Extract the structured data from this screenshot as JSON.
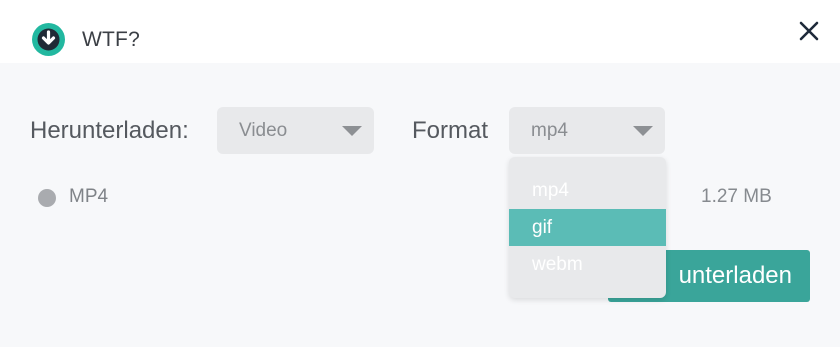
{
  "window": {
    "title": "WTF?",
    "logo_icon": "download-circle-icon",
    "close_icon": "close-icon"
  },
  "form": {
    "download_label": "Herunterladen:",
    "type_select": {
      "value": "Video",
      "icon": "caret-down-icon"
    },
    "format_label": "Format",
    "format_select": {
      "value": "mp4",
      "icon": "caret-down-icon"
    },
    "format_options": [
      "mp4",
      "gif",
      "webm"
    ],
    "highlighted_option": "gif"
  },
  "file": {
    "radio_label": "MP4",
    "size": "1.27 MB"
  },
  "actions": {
    "download_button": "Herunterladen",
    "download_button_visible": "unterladen"
  },
  "colors": {
    "accent": "#3aa59a",
    "highlight": "#5bbcb6",
    "select_bg": "#e8e9eb",
    "background": "#f7f8fa"
  }
}
